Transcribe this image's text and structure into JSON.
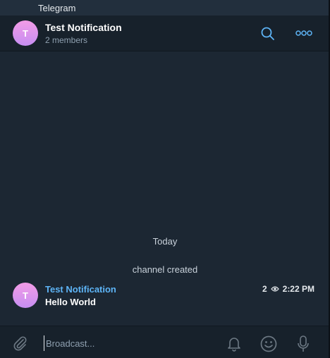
{
  "window": {
    "title": "Telegram"
  },
  "header": {
    "avatar_letter": "T",
    "title": "Test Notification",
    "subtitle": "2 members",
    "icons": [
      "search-icon",
      "more-icon"
    ]
  },
  "messages": {
    "date": "Today",
    "service": "channel created",
    "items": [
      {
        "avatar_letter": "T",
        "author": "Test Notification",
        "text": "Hello World",
        "views": "2",
        "time": "2:22 PM"
      }
    ]
  },
  "composer": {
    "placeholder": "Broadcast...",
    "icons": [
      "paperclip-icon",
      "bell-icon",
      "emoji-icon",
      "microphone-icon"
    ]
  },
  "colors": {
    "accent": "#5eb5f7",
    "background": "#1c2733",
    "header": "#17212b",
    "avatar": "#e59ae8"
  }
}
